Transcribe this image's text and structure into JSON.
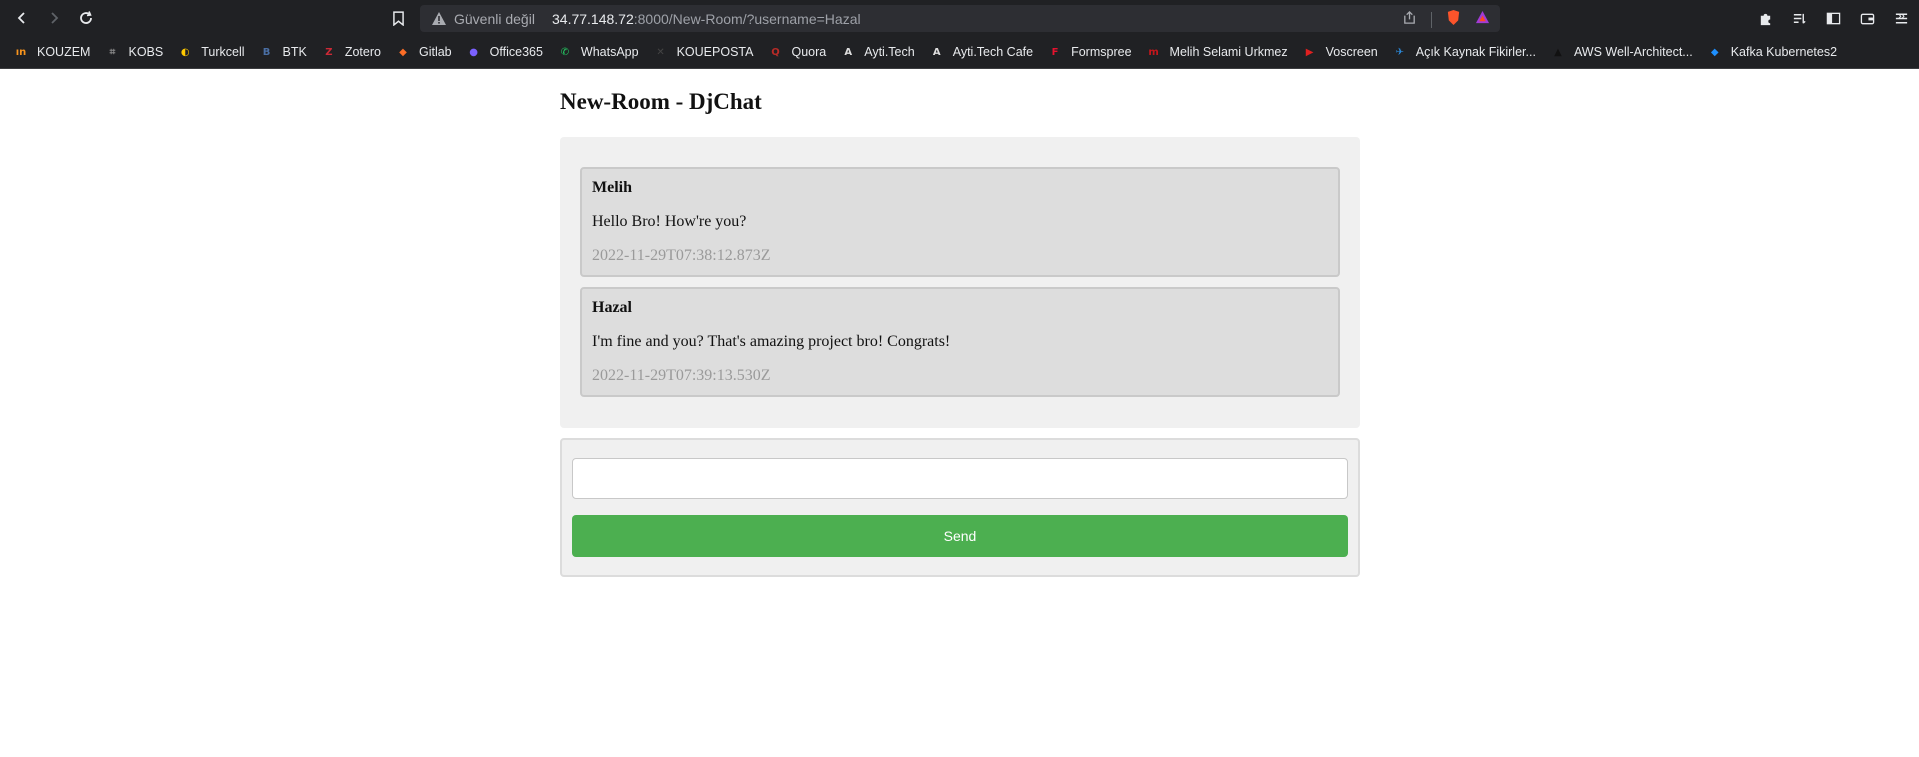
{
  "browser": {
    "security_label": "Güvenli değil",
    "url_host": "34.77.148.72",
    "url_rest": ":8000/New-Room/?username=Hazal"
  },
  "bookmarks": [
    {
      "label": "KOUZEM",
      "icon": "kouzem-icon",
      "glyph": "ın",
      "color": "#f7941d"
    },
    {
      "label": "KOBS",
      "icon": "kobs-icon",
      "glyph": "⌗",
      "color": "#8a8a8a"
    },
    {
      "label": "Turkcell",
      "icon": "turkcell-icon",
      "glyph": "◐",
      "color": "#ffc900"
    },
    {
      "label": "BTK",
      "icon": "btk-icon",
      "glyph": "B",
      "color": "#4a6fa5"
    },
    {
      "label": "Zotero",
      "icon": "zotero-icon",
      "glyph": "Z",
      "color": "#cc2936"
    },
    {
      "label": "Gitlab",
      "icon": "gitlab-icon",
      "glyph": "◆",
      "color": "#fc6d26"
    },
    {
      "label": "Office365",
      "icon": "office365-icon",
      "glyph": "●",
      "color": "#7b61ff"
    },
    {
      "label": "WhatsApp",
      "icon": "whatsapp-icon",
      "glyph": "✆",
      "color": "#25d366"
    },
    {
      "label": "KOUEPOSTA",
      "icon": "kouposta-icon",
      "glyph": "✕",
      "color": "#444444"
    },
    {
      "label": "Quora",
      "icon": "quora-icon",
      "glyph": "Q",
      "color": "#b92b27"
    },
    {
      "label": "Ayti.Tech",
      "icon": "aytitech-icon",
      "glyph": "A",
      "color": "#dddddd"
    },
    {
      "label": "Ayti.Tech Cafe",
      "icon": "aytitech-cafe-icon",
      "glyph": "A",
      "color": "#dddddd"
    },
    {
      "label": "Formspree",
      "icon": "formspree-icon",
      "glyph": "F",
      "color": "#e5122e"
    },
    {
      "label": "Melih Selami Urkmez",
      "icon": "melih-site-icon",
      "glyph": "m",
      "color": "#c4161c"
    },
    {
      "label": "Voscreen",
      "icon": "voscreen-icon",
      "glyph": "▶",
      "color": "#e02020"
    },
    {
      "label": "Açık Kaynak Fikirler...",
      "icon": "acik-kaynak-icon",
      "glyph": "✈",
      "color": "#2b88d8"
    },
    {
      "label": "AWS Well-Architect...",
      "icon": "aws-icon",
      "glyph": "▲",
      "color": "#111111"
    },
    {
      "label": "Kafka Kubernetes2",
      "icon": "kafka-icon",
      "glyph": "◆",
      "color": "#1e90ff"
    }
  ],
  "page": {
    "title": "New-Room - DjChat"
  },
  "messages": [
    {
      "author": "Melih",
      "text": "Hello Bro! How're you?",
      "time": "2022-11-29T07:38:12.873Z"
    },
    {
      "author": "Hazal",
      "text": "I'm fine and you? That's amazing project bro! Congrats!",
      "time": "2022-11-29T07:39:13.530Z"
    }
  ],
  "compose": {
    "input_value": "",
    "send_label": "Send"
  },
  "colors": {
    "send_button": "#4caf50",
    "panel_bg": "#f0f0f0",
    "message_bg": "#dddddd"
  }
}
